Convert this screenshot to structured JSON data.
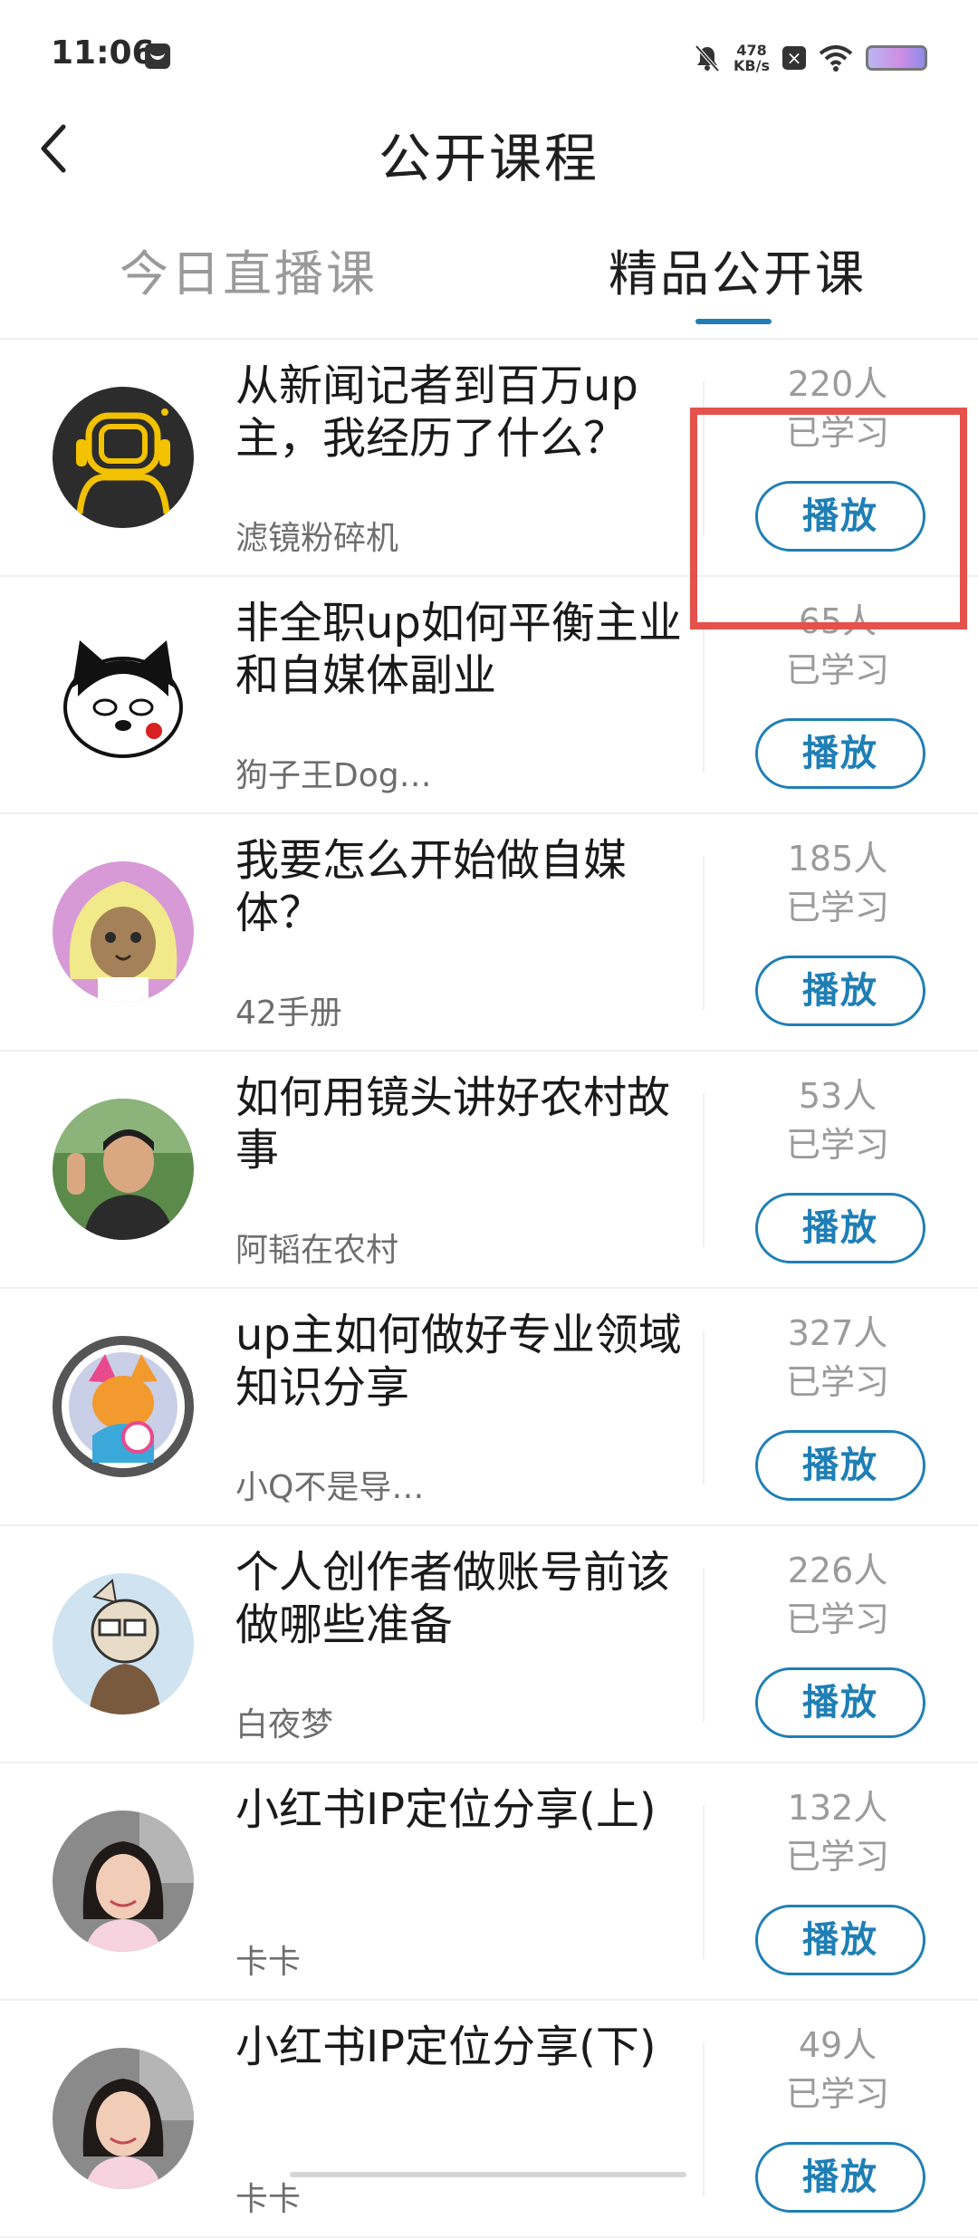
{
  "status_bar": {
    "time": "11:06",
    "net_speed_value": "478",
    "net_speed_unit": "KB/s"
  },
  "header": {
    "title": "公开课程"
  },
  "tabs": [
    {
      "label": "今日直播课",
      "active": false
    },
    {
      "label": "精品公开课",
      "active": true
    }
  ],
  "colors": {
    "accent": "#1f7fb5",
    "highlight": "#e5514b",
    "muted_text": "#9b9b9b"
  },
  "courses": [
    {
      "title": "从新闻记者到百万up主，我经历了什么？",
      "author": "滤镜粉碎机",
      "count": "220人",
      "studied": "已学习",
      "play_label": "播放",
      "avatar_icon": "astronaut-helmet-icon"
    },
    {
      "title": "非全职up如何平衡主业和自媒体副业",
      "author": "狗子王Dog…",
      "count": "65人",
      "studied": "已学习",
      "play_label": "播放",
      "avatar_icon": "cartoon-dog-icon"
    },
    {
      "title": "我要怎么开始做自媒体？",
      "author": "42手册",
      "count": "185人",
      "studied": "已学习",
      "play_label": "播放",
      "avatar_icon": "cat-wig-icon"
    },
    {
      "title": "如何用镜头讲好农村故事",
      "author": "阿韬在农村",
      "count": "53人",
      "studied": "已学习",
      "play_label": "播放",
      "avatar_icon": "man-photo-icon"
    },
    {
      "title": "up主如何做好专业领域知识分享",
      "author": "小Q不是导…",
      "count": "327人",
      "studied": "已学习",
      "play_label": "播放",
      "avatar_icon": "colorful-fox-icon"
    },
    {
      "title": "个人创作者做账号前该做哪些准备",
      "author": "白夜梦",
      "count": "226人",
      "studied": "已学习",
      "play_label": "播放",
      "avatar_icon": "glasses-character-icon"
    },
    {
      "title": "小红书IP定位分享(上)",
      "author": "卡卡",
      "count": "132人",
      "studied": "已学习",
      "play_label": "播放",
      "avatar_icon": "woman-photo-icon"
    },
    {
      "title": "小红书IP定位分享(下)",
      "author": "卡卡",
      "count": "49人",
      "studied": "已学习",
      "play_label": "播放",
      "avatar_icon": "woman-photo-icon"
    }
  ]
}
